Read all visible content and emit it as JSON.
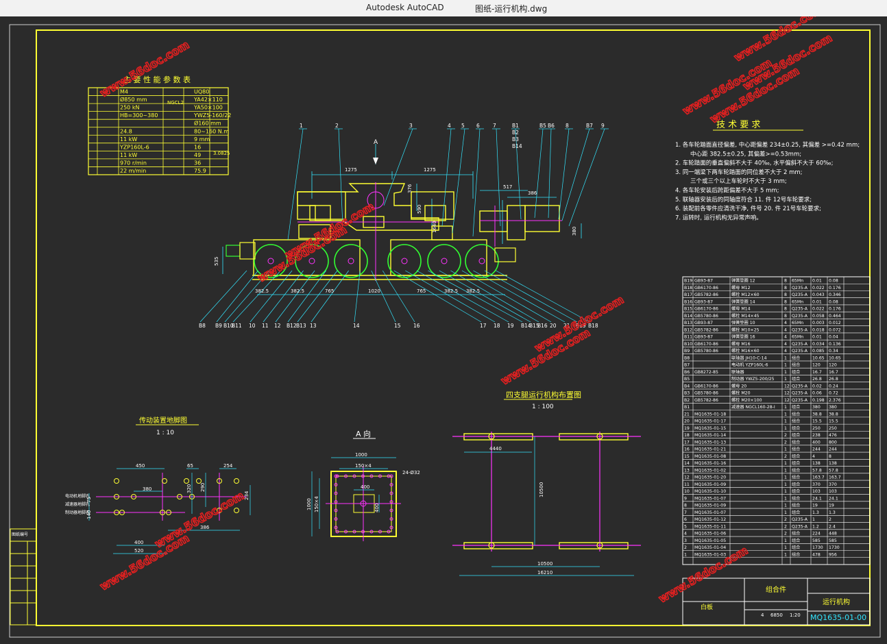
{
  "window": {
    "app_name": "Autodesk AutoCAD",
    "document_title": "图纸-运行机构.dwg"
  },
  "watermark": "www.56doc.com",
  "colors": {
    "background": "#2b2b2b",
    "frame": "#ffff33",
    "cyan": "#33e6ff",
    "magenta": "#ff33ff",
    "green": "#33ff33",
    "white": "#ffffff",
    "watermark": "#e02020"
  },
  "drawing": {
    "param_table_title": "主 要 性 能 参 数 表",
    "param_table_rows": [
      [
        "M4",
        "UQ80"
      ],
      [
        "Ø850 mm",
        "YA42×110"
      ],
      [
        "250 kN",
        "YA50×100"
      ],
      [
        "HB=300~380",
        "YWZ5-160/22"
      ],
      [
        "",
        "Ø160 mm"
      ],
      [
        "24.8",
        "80~160 N.m"
      ],
      [
        "11 kW",
        "9 mm"
      ],
      [
        "YZP160L-6",
        "16"
      ],
      [
        "11 kW",
        "49"
      ],
      [
        "970 r/min",
        "36"
      ],
      [
        "22 m/min",
        "75.9"
      ]
    ],
    "param_table_side": "3.0825",
    "param_table_col_label": "NGCL2",
    "tech_title": "技 术 要 求",
    "tech_requirements": [
      "1. 各车轮踏面直径偏差, 中心距偏差 234±0.25, 其偏差 >=0.42 mm;",
      "中心距 382.5±0.25, 其偏差>=0.53mm;",
      "2. 车轮踏面的垂直偏斜不大于 40‰, 水平偏斜不大于 60‰;",
      "3. 同一端梁下两车轮踏面的同位差不大于 2 mm;",
      "三个或三个以上车轮时不大于 3 mm;",
      "4. 各车轮安装后跨距偏差不大于 5 mm;",
      "5. 联轴器安装后的同轴度符合 11. 件 12号车轮要求;",
      "6. 装配前各零件应清洗干净, 件号 20. 件 21号车轮要求;",
      "7. 运转时, 运行机构无异常声响。"
    ],
    "section_label_a": "A",
    "section_title_a": "A 向",
    "plan_title": "传动装置地脚图",
    "plan_scale": "1 : 10",
    "layout_title": "四支腿运行机构布置图",
    "layout_scale": "1 : 100",
    "main_dims": [
      "1275",
      "1275",
      "517",
      "386",
      "376",
      "590",
      "1640",
      "380",
      "535"
    ],
    "bottom_dims": [
      "382.5",
      "382.5",
      "765",
      "1020",
      "765",
      "382.5",
      "382.5"
    ],
    "top_labels": [
      "1",
      "2",
      "3",
      "4",
      "5",
      "6",
      "7",
      "B1",
      "B2",
      "B3",
      "B14",
      "B5",
      "B6",
      "8",
      "B7",
      "9"
    ],
    "bottom_labels": [
      "B8",
      "B9",
      "B10",
      "B11",
      "10",
      "11",
      "12",
      "B12",
      "B13",
      "13",
      "14",
      "15",
      "16",
      "17",
      "18",
      "19",
      "B14",
      "B15",
      "B16",
      "20",
      "21",
      "B19",
      "B18"
    ],
    "plan_dims": [
      "450",
      "65",
      "254",
      "380",
      "75",
      "140",
      "320",
      "290",
      "234",
      "386",
      "400",
      "520"
    ],
    "plan_notes": [
      "电动机地脚孔",
      "减速器地脚孔",
      "制动器地脚孔"
    ],
    "a_view_dims": [
      "1000",
      "150×4",
      "400",
      "1000",
      "150×4",
      "400",
      "24-Ø32"
    ],
    "layout_dims": [
      "4440",
      "10500",
      "10500",
      "16210"
    ],
    "bom_rows": [
      [
        "B19",
        "GB93-87",
        "弹簧垫圈 12",
        "8",
        "65Mn",
        "0.01",
        "0.08"
      ],
      [
        "B18",
        "GB6170-86",
        "螺母 M12",
        "8",
        "Q235-A",
        "0.022",
        "0.176"
      ],
      [
        "B17",
        "GB5782-86",
        "螺栓 M12×60",
        "8",
        "Q235-A",
        "0.043",
        "0.346"
      ],
      [
        "B16",
        "GB93-87",
        "弹簧垫圈 14",
        "8",
        "65Mn",
        "0.01",
        "0.08"
      ],
      [
        "B15",
        "GB6170-86",
        "螺母 M14",
        "8",
        "Q235-A",
        "0.022",
        "0.176"
      ],
      [
        "B14",
        "GB5780-86",
        "螺栓 M14×45",
        "8",
        "Q235-A",
        "0.058",
        "0.464"
      ],
      [
        "B13",
        "GB93-87",
        "弹簧垫圈 10",
        "4",
        "65Mn",
        "0.003",
        "0.012"
      ],
      [
        "B12",
        "GB5782-86",
        "螺栓 M10×25",
        "4",
        "Q235-A",
        "0.018",
        "0.072"
      ],
      [
        "B11",
        "GB93-87",
        "弹簧垫圈 16",
        "4",
        "65Mn",
        "0.01",
        "0.04"
      ],
      [
        "B10",
        "GB6170-86",
        "螺母 M16",
        "4",
        "Q235-A",
        "0.034",
        "0.136"
      ],
      [
        "B9",
        "GB5780-86",
        "螺栓 M16×60",
        "4",
        "Q235-A",
        "0.085",
        "0.34"
      ],
      [
        "B8",
        "",
        "联轴器 JH10-C-14",
        "1",
        "组合",
        "10.65",
        "10.65"
      ],
      [
        "B7",
        "",
        "电动机 YZP160L-6",
        "1",
        "组合",
        "120",
        "120"
      ],
      [
        "B6",
        "GB8272-85",
        "联轴器",
        "1",
        "组合",
        "16.7",
        "16.7"
      ],
      [
        "B5",
        "",
        "制动器 YWZ5-200/25",
        "1",
        "组合",
        "26.8",
        "26.8"
      ],
      [
        "B4",
        "GB6170-86",
        "螺母 20",
        "12",
        "Q235-A",
        "0.02",
        "0.24"
      ],
      [
        "B3",
        "GB5780-86",
        "螺栓 M20",
        "12",
        "Q235-A",
        "0.06",
        "0.72"
      ],
      [
        "B2",
        "GB5782-86",
        "螺栓 M20×100",
        "12",
        "Q235-A",
        "0.198",
        "2.376"
      ],
      [
        "B1",
        "",
        "减速器 NGCL160-28-I",
        "1",
        "组合",
        "380",
        "380"
      ],
      [
        "21",
        "MQ1635-01-18",
        "",
        "1",
        "组合",
        "38.8",
        "38.8"
      ],
      [
        "20",
        "MQ1635-01-17",
        "",
        "1",
        "组合",
        "15.5",
        "15.5"
      ],
      [
        "19",
        "MQ1635-01-15",
        "",
        "1",
        "组合",
        "250",
        "250"
      ],
      [
        "18",
        "MQ1635-01-14",
        "",
        "2",
        "组合",
        "238",
        "476"
      ],
      [
        "17",
        "MQ1635-01-13",
        "",
        "2",
        "组合",
        "400",
        "800"
      ],
      [
        "16",
        "MQ1635-01-21",
        "",
        "1",
        "组合",
        "244",
        "244"
      ],
      [
        "15",
        "MQ1635-01-08",
        "",
        "2",
        "组合",
        "4",
        "8"
      ],
      [
        "14",
        "MQ1635-01-16",
        "",
        "1",
        "组合",
        "138",
        "138"
      ],
      [
        "13",
        "MQ1635-01-02",
        "",
        "1",
        "组合",
        "57.8",
        "57.8"
      ],
      [
        "12",
        "MQ1635-01-20",
        "",
        "1",
        "组合",
        "163.7",
        "163.7"
      ],
      [
        "11",
        "MQ1635-01-09",
        "",
        "1",
        "组合",
        "370",
        "370"
      ],
      [
        "10",
        "MQ1635-01-10",
        "",
        "1",
        "组合",
        "103",
        "103"
      ],
      [
        "9",
        "MQ1635-01-07",
        "",
        "1",
        "组合",
        "24.1",
        "24.1"
      ],
      [
        "8",
        "MQ1635-01-09",
        "",
        "1",
        "组合",
        "19",
        "19"
      ],
      [
        "7",
        "MQ1635-01-07",
        "",
        "1",
        "组合",
        "1.3",
        "1.3"
      ],
      [
        "6",
        "MQ1635-01-12",
        "",
        "2",
        "Q235-A",
        "1",
        "2"
      ],
      [
        "5",
        "MQ1635-01-11",
        "",
        "2",
        "Q235-A",
        "1.2",
        "2.4"
      ],
      [
        "4",
        "MQ1635-01-06",
        "",
        "2",
        "组合",
        "224",
        "448"
      ],
      [
        "3",
        "MQ1635-01-05",
        "",
        "1",
        "组合",
        "585",
        "585"
      ],
      [
        "2",
        "MQ1635-01-04",
        "",
        "1",
        "组合",
        "1730",
        "1730"
      ],
      [
        "1",
        "MQ1635-01-03",
        "",
        "1",
        "组合",
        "478",
        "956"
      ]
    ],
    "title_block": {
      "group": "组合件",
      "name": "运行机构",
      "drawing_no": "MQ1635-01-00",
      "mass": "6850",
      "scale": "1:20",
      "sheets": "4",
      "material_label": "白板"
    },
    "left_strip_label": "图纸编号"
  }
}
